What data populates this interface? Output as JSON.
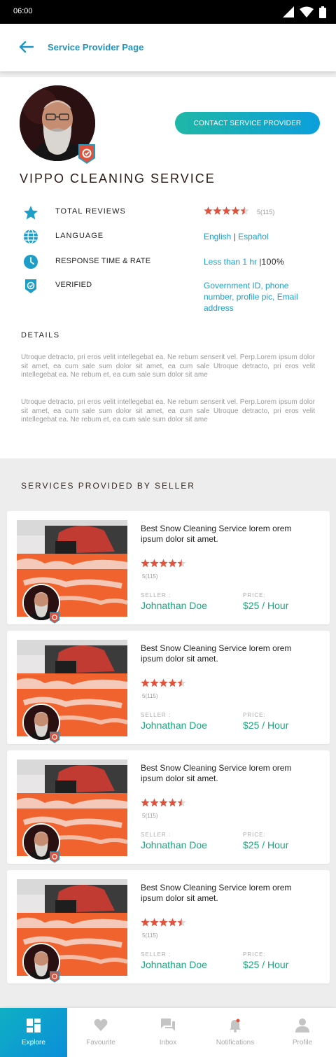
{
  "status_bar": {
    "time": "06:00"
  },
  "header": {
    "title": "Service Provider Page"
  },
  "profile": {
    "contact_button": "CONTACT SERVICE PROVIDER",
    "name": "VIPPO CLEANING SERVICE",
    "rows": {
      "reviews": {
        "label": "TOTAL REVIEWS",
        "rating": 4.5,
        "count": "5(115)"
      },
      "language": {
        "label": "LANGUAGE",
        "value_1": "English",
        "separator": "|",
        "value_2": "Español"
      },
      "response": {
        "label": "RESPONSE TIME & RATE",
        "value_1": "Less than 1 hr",
        "separator": "|",
        "value_2": "100%"
      },
      "verified": {
        "label": "VERIFIED",
        "value": "Government ID, phone number, profile pic, Email address"
      }
    }
  },
  "details": {
    "title": "DETAILS",
    "paragraphs": [
      "Utroque detracto, pri eros velit intellegebat ea. Ne rebum senserit vel. Perp.Lorem ipsum dolor sit amet, ea cum sale  sum dolor sit amet, ea cum sale Utroque detracto, pri eros velit intellegebat ea. Ne rebum et, ea cum sale  sum dolor sit ame",
      "Utroque detracto, pri eros velit intellegebat ea. Ne rebum senserit vel. Perp.Lorem ipsum dolor sit amet, ea cum sale  sum dolor sit amet, ea cum sale Utroque detracto, pri eros velit intellegebat ea. Ne rebum et, ea cum sale  sum dolor sit ame"
    ]
  },
  "services": {
    "title": "SERVICES PROVIDED BY SELLER",
    "seller_label": "SELLER :",
    "price_label": "PRICE:",
    "items": [
      {
        "title": "Best Snow Cleaning Service lorem orem ipsum dolor sit amet.",
        "rating": 4.5,
        "count": "5(115)",
        "seller": "Johnathan Doe",
        "price": "$25 / Hour"
      },
      {
        "title": "Best Snow Cleaning Service lorem orem ipsum dolor sit amet.",
        "rating": 4.5,
        "count": "5(115)",
        "seller": "Johnathan Doe",
        "price": "$25 / Hour"
      },
      {
        "title": "Best Snow Cleaning Service lorem orem ipsum dolor sit amet.",
        "rating": 4.5,
        "count": "5(115)",
        "seller": "Johnathan Doe",
        "price": "$25 / Hour"
      },
      {
        "title": "Best Snow Cleaning Service lorem orem ipsum dolor sit amet.",
        "rating": 4.5,
        "count": "5(115)",
        "seller": "Johnathan Doe",
        "price": "$25 / Hour"
      }
    ]
  },
  "nav": {
    "items": [
      {
        "label": "Explore",
        "icon": "explore-icon",
        "active": true
      },
      {
        "label": "Favourite",
        "icon": "heart-icon",
        "active": false
      },
      {
        "label": "Inbox",
        "icon": "chat-icon",
        "active": false
      },
      {
        "label": "Notifications",
        "icon": "bell-icon",
        "active": false
      },
      {
        "label": "Profile",
        "icon": "person-icon",
        "active": false
      }
    ]
  },
  "colors": {
    "accent": "#1d9ec9",
    "star": "#e0523c",
    "price_green": "#1aa77f",
    "badge_red": "#e0523c",
    "badge_teal": "#1d9ec9"
  }
}
